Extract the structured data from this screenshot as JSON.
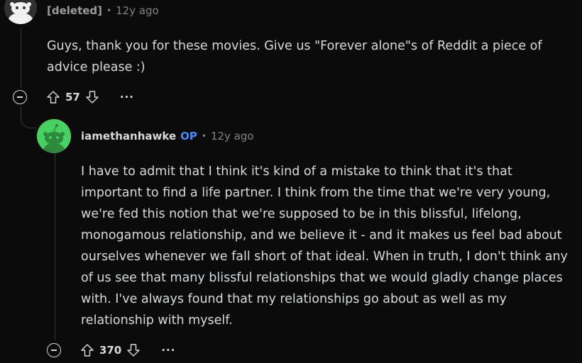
{
  "comments": [
    {
      "author": "[deleted]",
      "time": "12y ago",
      "body": "Guys, thank you for these movies. Give us \"Forever alone\"s of Reddit a piece of advice please :)",
      "score": "57",
      "avatar_icon": "snoo-default-avatar"
    },
    {
      "author": "iamethanhawke",
      "badge": "OP",
      "time": "12y ago",
      "body": "I have to admit that I think it's kind of a mistake to think that it's that important to find a life partner. I think from the time that we're very young, we're fed this notion that we're supposed to be in this blissful, lifelong, monogamous relationship, and we believe it - and it makes us feel bad about ourselves whenever we fall short of that ideal. When in truth, I don't think any of us see that many blissful relationships that we would gladly change places with. I've always found that my relationships go about as well as my relationship with myself.",
      "score": "370",
      "avatar_icon": "snoo-green-avatar"
    }
  ],
  "ui": {
    "separator": "•",
    "more_label": "···"
  },
  "colors": {
    "background": "#0b0b0b",
    "text": "#d7dadc",
    "muted": "#818384",
    "op_badge": "#3a8dff",
    "avatar_green": "#46d160"
  }
}
